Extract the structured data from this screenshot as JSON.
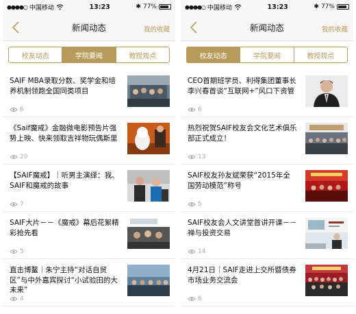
{
  "status": {
    "carrier": "中国移动",
    "time": "13:23",
    "battery": "77%",
    "battery_level": 0.77
  },
  "nav": {
    "title": "新闻动态",
    "favorites": "我的收藏"
  },
  "screens": [
    {
      "tabs": [
        {
          "label": "校友动态",
          "active": false
        },
        {
          "label": "学院要闻",
          "active": true
        },
        {
          "label": "教授观点",
          "active": false
        }
      ],
      "items": [
        {
          "title": "SAIF MBA录取分数、奖学金和培养机制领跑全国同类项目",
          "views": "6"
        },
        {
          "title": "《Saif魔戒》金融微电影预告片强势上映、快来领取吉祥物玩偶斯里",
          "views": "20"
        },
        {
          "title": "【SAIF魔戒】｜听男主演绎：我、SAIF和魔戒的故事",
          "views": "7"
        },
        {
          "title": "SAIF大片－－《魔戒》幕后花絮精彩抢先看",
          "views": "5"
        },
        {
          "title": "直击博鳌｜朱宁主持“对话自贸区”与中外嘉宾探讨“小试验田的大未来”",
          "views": "4"
        }
      ]
    },
    {
      "tabs": [
        {
          "label": "校友动态",
          "active": true
        },
        {
          "label": "学院要闻",
          "active": false
        },
        {
          "label": "教授观点",
          "active": false
        }
      ],
      "items": [
        {
          "title": "CEO首期班学员、利得集团董事长李兴春首谈“互联网+”风口下资管",
          "views": "6"
        },
        {
          "title": "热烈祝贺SAIF校友会文化艺术俱乐部正式成立！",
          "views": "13"
        },
        {
          "title": "SAIF校友孙友斌荣获“2015年全国劳动模范”称号",
          "views": "5"
        },
        {
          "title": "SAIF校友会人文讲堂首讲开课－－禅与投资交易",
          "views": "14"
        },
        {
          "title": "4月21日｜SAIF走进上交所暨债券市场业务交流会",
          "views": "6"
        }
      ]
    }
  ],
  "colors": {
    "accent": "#b89a5a"
  }
}
